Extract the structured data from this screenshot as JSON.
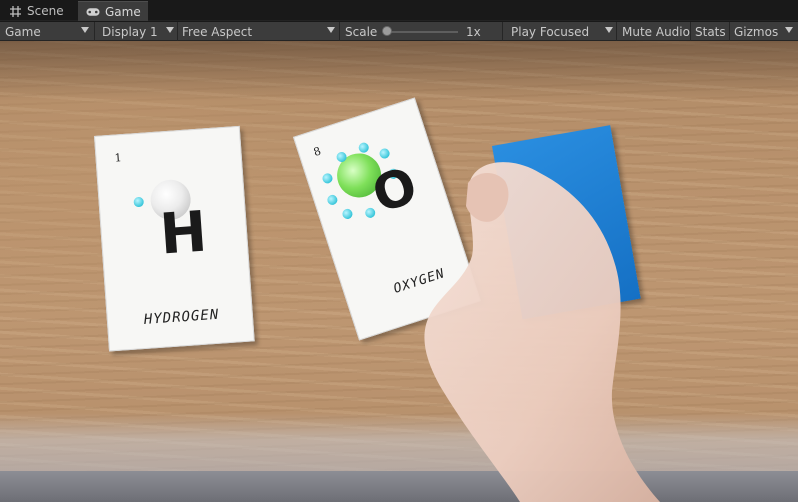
{
  "tabs": [
    {
      "label": "Scene",
      "icon": "grid-icon"
    },
    {
      "label": "Game",
      "icon": "gamepad-icon"
    }
  ],
  "toolbar": {
    "view_select": "Game",
    "display_select": "Display 1",
    "aspect_select": "Free Aspect",
    "scale_label": "Scale",
    "scale_value": "1x",
    "play_mode_select": "Play Focused",
    "mute_audio": "Mute Audio",
    "stats": "Stats",
    "gizmos": "Gizmos"
  },
  "scene": {
    "cards": [
      {
        "number": "1",
        "symbol": "H",
        "name": "HYDROGEN",
        "nucleus_color": "#e8e8e8"
      },
      {
        "number": "8",
        "symbol": "O",
        "name": "OXYGEN",
        "nucleus_color": "#7fe05a"
      }
    ],
    "electron_color": "#38c6da",
    "marker_card_color": "#1e7fd6"
  }
}
